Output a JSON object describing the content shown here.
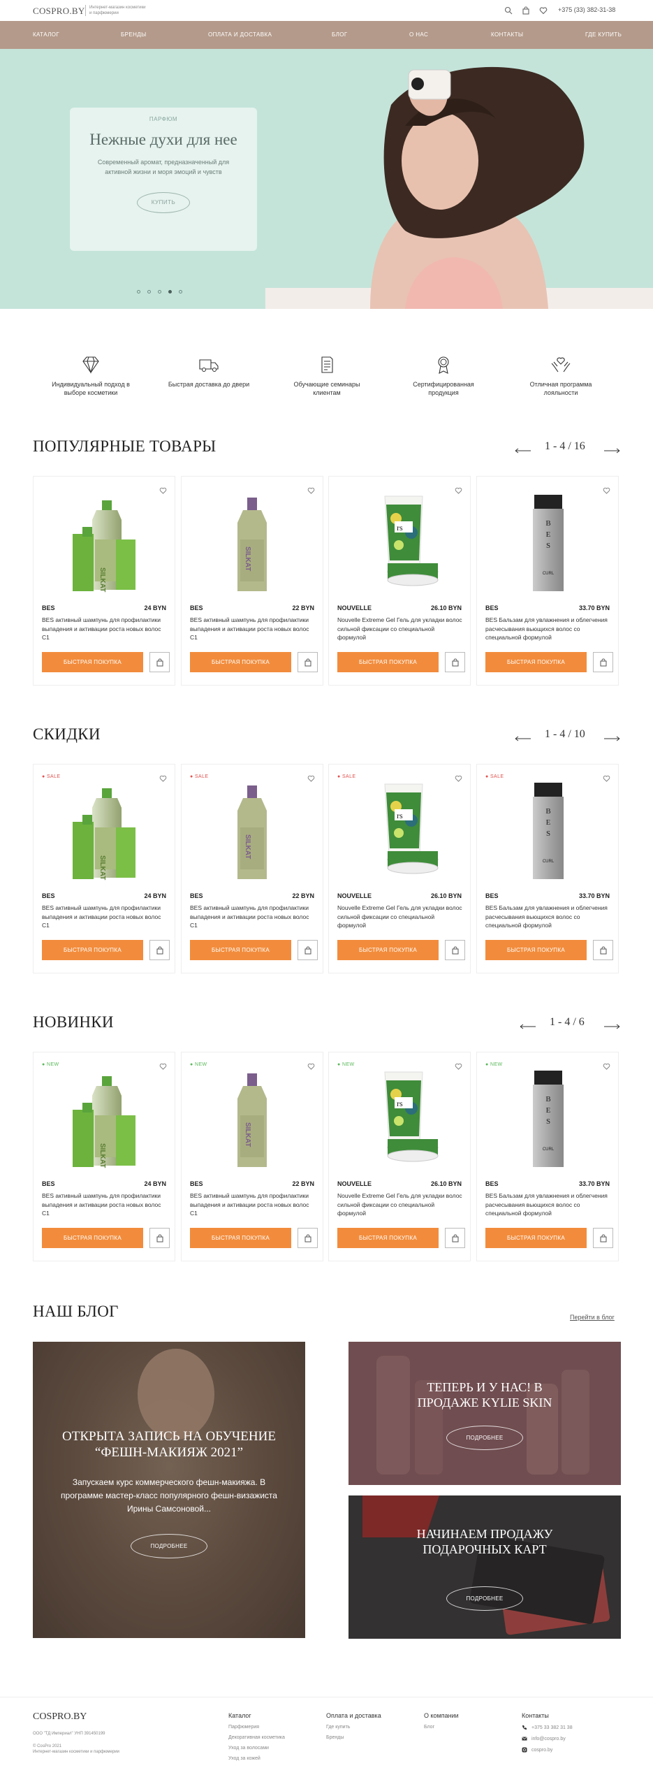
{
  "header": {
    "logo": "COSPRO.BY",
    "tagline": "Интернет-магазин косметики и парфюмерии",
    "phone": "+375 (33) 382-31-38",
    "icons": [
      "search-icon",
      "bag-icon",
      "heart-icon"
    ]
  },
  "nav": [
    "КАТАЛОГ",
    "БРЕНДЫ",
    "ОПЛАТА И ДОСТАВКА",
    "БЛОГ",
    "О НАС",
    "КОНТАКТЫ",
    "ГДЕ КУПИТЬ"
  ],
  "hero": {
    "overline": "ПАРФЮМ",
    "title": "Нежные духи для нее",
    "text": "Современный аромат, предназначенный для активной жизни и моря эмоций и чувств",
    "button": "КУПИТЬ",
    "slides": 5,
    "active_slide": 4
  },
  "features": [
    {
      "icon": "diamond-icon",
      "label": "Индивидуальный подход в выборе косметики"
    },
    {
      "icon": "truck-icon",
      "label": "Быстрая доставка до двери"
    },
    {
      "icon": "document-icon",
      "label": "Обучающие семинары клиентам"
    },
    {
      "icon": "award-icon",
      "label": "Сертифицированная продукция"
    },
    {
      "icon": "hands-heart-icon",
      "label": "Отличная программа лояльности"
    }
  ],
  "sections": [
    {
      "title": "ПОПУЛЯРНЫЕ ТОВАРЫ",
      "pager": "1 - 4 / 16",
      "badge": ""
    },
    {
      "title": "СКИДКИ",
      "pager": "1 - 4 / 10",
      "badge": "SALE"
    },
    {
      "title": "НОВИНКИ",
      "pager": "1 - 4 / 6",
      "badge": "NEW"
    }
  ],
  "products": [
    {
      "brand": "BES",
      "price": "24 BYN",
      "desc": "BES активный шампунь для профилактики выпадения и активации роста новых волос C1",
      "image": "silkat-bottle-with-box"
    },
    {
      "brand": "BES",
      "price": "22 BYN",
      "desc": "BES активный шампунь для профилактики выпадения и активации роста новых волос C1",
      "image": "silkat-bottle"
    },
    {
      "brand": "NOUVELLE",
      "price": "26.10 BYN",
      "desc": "Nouvelle Extreme Gel Гель для укладки волос сильной фиксации со специальной формулой",
      "image": "gel-tube-and-jar"
    },
    {
      "brand": "BES",
      "price": "33.70 BYN",
      "desc": "BES Бальзам для увлажнения и облегчения расчесывания вьющихся волос со специальной формулой",
      "image": "bes-curl-bottle"
    }
  ],
  "buttons": {
    "quick_buy": "БЫСТРАЯ ПОКУПКА",
    "more": "ПОДРОБНЕЕ"
  },
  "blog": {
    "title": "НАШ БЛОГ",
    "link": "Перейти в блог",
    "main": {
      "title": "ОТКРЫТА ЗАПИСЬ НА ОБУЧЕНИЕ “ФЕШН-МАКИЯЖ 2021”",
      "text": "Запускаем курс коммерческого фешн-макияжа. В программе мастер-класс популярного фешн-визажиста Ирины Самсоновой..."
    },
    "side1": {
      "title": "ТЕПЕРЬ И У НАС! В ПРОДАЖЕ KYLIE SKIN"
    },
    "side2": {
      "title": "НАЧИНАЕМ ПРОДАЖУ ПОДАРОЧНЫХ КАРТ"
    }
  },
  "footer": {
    "logo": "COSPRO.BY",
    "company": "ООО \"ТД Империал\" УНП 391450199",
    "copyright": "© CosPro 2021",
    "copyright2": "Интернет-магазин косметики и парфюмерии",
    "columns": [
      {
        "title": "Каталог",
        "items": [
          "Парфюмерия",
          "Декоративная косметика",
          "Уход за волосами",
          "Уход за кожей"
        ]
      },
      {
        "title": "Оплата и доставка",
        "items": [
          "Где купить",
          "Бренды"
        ]
      },
      {
        "title": "О компании",
        "items": [
          "Блог"
        ]
      }
    ],
    "contacts_title": "Контакты",
    "contacts": [
      {
        "icon": "phone-icon",
        "text": "+375 33 382 31 38"
      },
      {
        "icon": "mail-icon",
        "text": "info@cospro.by"
      },
      {
        "icon": "instagram-icon",
        "text": "cospro.by"
      }
    ]
  },
  "colors": {
    "nav": "#b49a8a",
    "accent": "#f28c3c",
    "sale": "#e0524f",
    "new": "#5cb85c"
  }
}
